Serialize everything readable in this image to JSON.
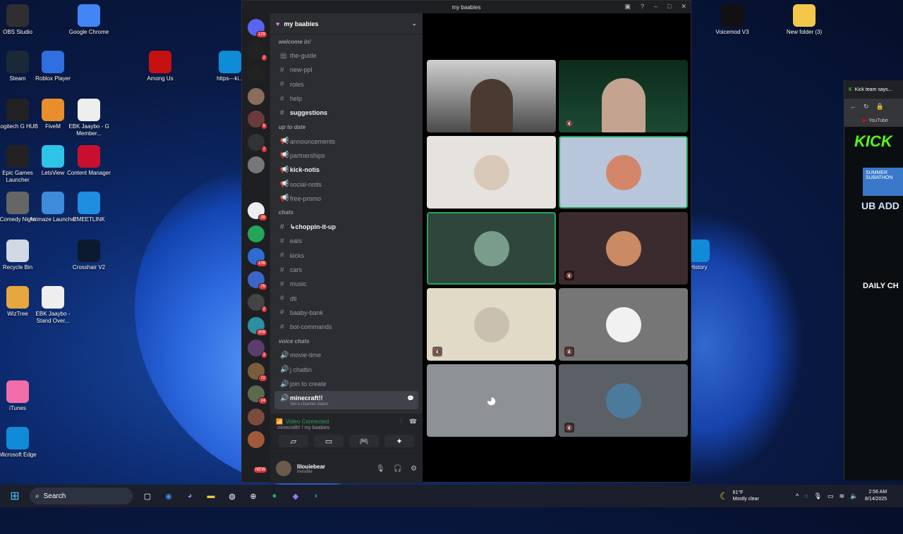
{
  "desktop": {
    "icons": [
      {
        "label": "OBS Studio",
        "icon": "obs-icon",
        "color": "#302e31"
      },
      {
        "label": "Google Chrome",
        "icon": "chrome-icon",
        "color": "#4285f4"
      },
      {
        "label": "Steam",
        "icon": "steam-icon",
        "color": "#1b2838"
      },
      {
        "label": "Roblox Player",
        "icon": "roblox-icon",
        "color": "#2f6fe0"
      },
      {
        "label": "Among Us",
        "icon": "among-us-icon",
        "color": "#c51111"
      },
      {
        "label": "https---ki...",
        "icon": "edge-icon",
        "color": "#0f8bd8"
      },
      {
        "label": "Logitech G HUB",
        "icon": "logitech-icon",
        "color": "#222"
      },
      {
        "label": "FiveM",
        "icon": "fivem-icon",
        "color": "#e98e2c"
      },
      {
        "label": "EBK Jaaybo - G Member...",
        "icon": "video-icon",
        "color": "#eee"
      },
      {
        "label": "Epic Games Launcher",
        "icon": "epic-icon",
        "color": "#222"
      },
      {
        "label": "LetsView",
        "icon": "letsview-icon",
        "color": "#2ec4e8"
      },
      {
        "label": "Content Manager",
        "icon": "content-manager-icon",
        "color": "#c8102e"
      },
      {
        "label": "Comedy Night",
        "icon": "microphone-icon",
        "color": "#666"
      },
      {
        "label": "Animaze Launcher",
        "icon": "animaze-icon",
        "color": "#3d8bd9"
      },
      {
        "label": "EMEETLINK",
        "icon": "emeetlink-icon",
        "color": "#1f8de0"
      },
      {
        "label": "Recycle Bin",
        "icon": "recycle-bin-icon",
        "color": "#cfd8e3"
      },
      {
        "label": "Crosshair V2",
        "icon": "crosshair-icon",
        "color": "#0b1a2e"
      },
      {
        "label": "WizTree",
        "icon": "wiztree-icon",
        "color": "#e6a640"
      },
      {
        "label": "EBK Jaaybo - Stand Over...",
        "icon": "video-icon",
        "color": "#eee"
      },
      {
        "label": "iTunes",
        "icon": "itunes-icon",
        "color": "#f06ea9"
      },
      {
        "label": "Microsoft Edge",
        "icon": "edge-icon",
        "color": "#0f8bd8"
      },
      {
        "label": "Voicemod V3",
        "icon": "voicemod-icon",
        "color": "#111"
      },
      {
        "label": "New folder (3)",
        "icon": "folder-icon",
        "color": "#f3c74a"
      },
      {
        "label": "History",
        "icon": "edge-icon",
        "color": "#0f8bd8"
      }
    ]
  },
  "discord": {
    "window_title": "my baabies",
    "server_name": "my baabies",
    "server_badges": [
      "129",
      "2",
      "",
      "",
      "5",
      "7",
      "",
      "",
      "38",
      "",
      "138",
      "76",
      "2",
      "309",
      "3",
      "72",
      "14",
      "",
      "",
      "NEW"
    ],
    "channels": [
      {
        "type": "cat",
        "label": "welcome in!"
      },
      {
        "type": "text",
        "label": "the-guide",
        "icon": "rules-icon"
      },
      {
        "type": "text",
        "label": "new-ppl"
      },
      {
        "type": "text",
        "label": "roles"
      },
      {
        "type": "text",
        "label": "help"
      },
      {
        "type": "text",
        "label": "suggestions",
        "bold": true
      },
      {
        "type": "cat",
        "label": "up to date"
      },
      {
        "type": "text",
        "label": "announcements",
        "icon": "announce-icon"
      },
      {
        "type": "text",
        "label": "partnerships",
        "icon": "announce-icon"
      },
      {
        "type": "text",
        "label": "kick-notis",
        "icon": "announce-icon",
        "bold": true
      },
      {
        "type": "text",
        "label": "social-notis",
        "icon": "announce-icon"
      },
      {
        "type": "text",
        "label": "free-promo",
        "icon": "announce-icon"
      },
      {
        "type": "cat",
        "label": "chats"
      },
      {
        "type": "text",
        "label": "↳choppin-it-up",
        "bold": true
      },
      {
        "type": "text",
        "label": "eats"
      },
      {
        "type": "text",
        "label": "kicks"
      },
      {
        "type": "text",
        "label": "cars"
      },
      {
        "type": "text",
        "label": "music"
      },
      {
        "type": "text",
        "label": "dti"
      },
      {
        "type": "text",
        "label": "baaby-bank"
      },
      {
        "type": "text",
        "label": "bot-commands"
      },
      {
        "type": "cat",
        "label": "voice chats"
      },
      {
        "type": "voice",
        "label": "movie-time"
      },
      {
        "type": "voice",
        "label": "j chattin"
      },
      {
        "type": "voice",
        "label": "join to create"
      }
    ],
    "active_channel": {
      "label": "minecraft!!",
      "sub": "Set a channel status"
    },
    "voice_status": {
      "title": "Video Connected",
      "sub": "minecraft!! / my baabies"
    },
    "user": {
      "name": "lilouiebear",
      "status": "Invisible"
    },
    "colors": {
      "connected": "#23a55a",
      "badge": "#da373c",
      "accent": "#5865f2"
    }
  },
  "kick": {
    "tab_title": "Kick team says...",
    "bookmark": "YouTube",
    "banner": "KICK",
    "sub_text": "SUMMER SUBATHON",
    "ticker": "UB ADD",
    "daily": "DAILY CH"
  },
  "taskbar": {
    "search_placeholder": "Search",
    "weather_temp": "61°F",
    "weather_desc": "Mostly clear",
    "time": "2:56 AM",
    "date": "8/14/2025"
  }
}
